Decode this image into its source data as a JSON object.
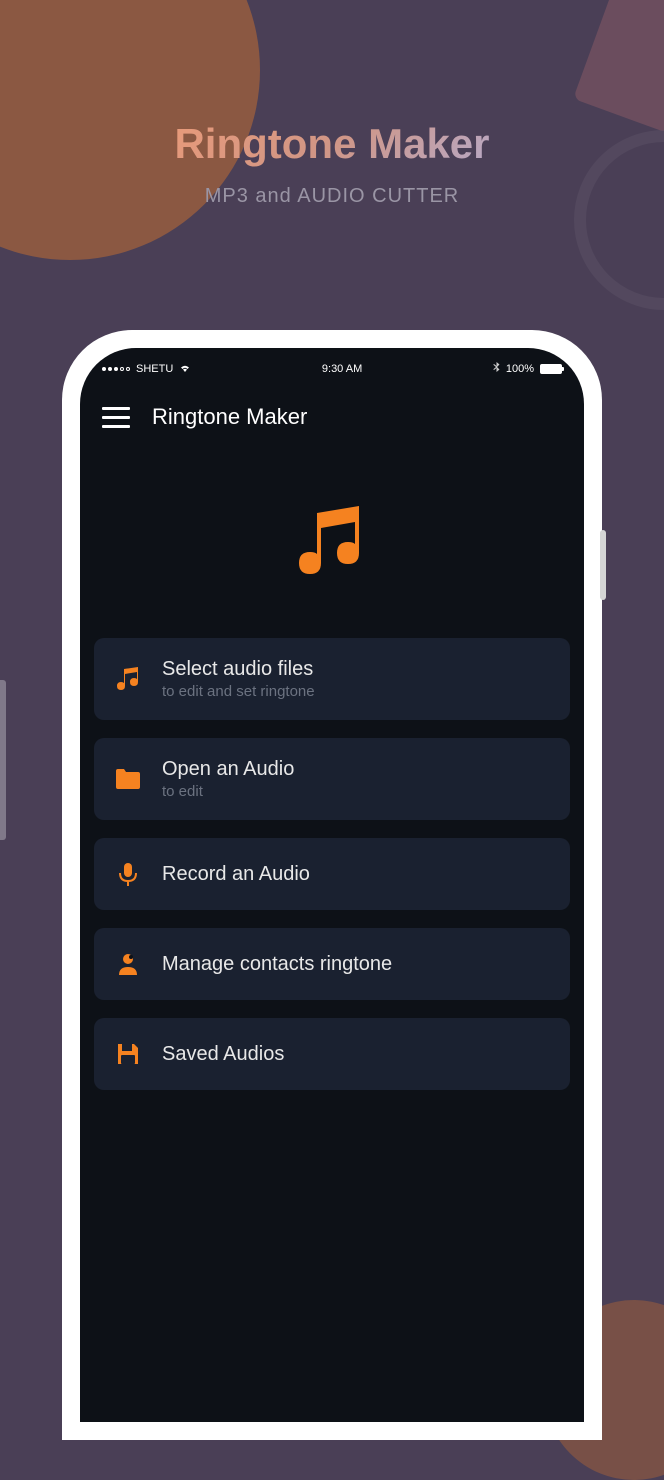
{
  "promo": {
    "title": "Ringtone Maker",
    "subtitle": "MP3 and AUDIO CUTTER"
  },
  "status_bar": {
    "carrier": "SHETU",
    "time": "9:30 AM",
    "battery": "100%"
  },
  "app": {
    "title": "Ringtone Maker"
  },
  "menu": {
    "items": [
      {
        "title": "Select audio files",
        "subtitle": "to edit and set ringtone",
        "icon": "music-note-icon"
      },
      {
        "title": "Open an Audio",
        "subtitle": "to edit",
        "icon": "folder-icon"
      },
      {
        "title": "Record an Audio",
        "subtitle": "",
        "icon": "microphone-icon"
      },
      {
        "title": "Manage contacts ringtone",
        "subtitle": "",
        "icon": "contact-icon"
      },
      {
        "title": "Saved Audios",
        "subtitle": "",
        "icon": "save-icon"
      }
    ]
  },
  "colors": {
    "accent": "#f58220",
    "background": "#0d1117",
    "card": "#1a2130"
  }
}
